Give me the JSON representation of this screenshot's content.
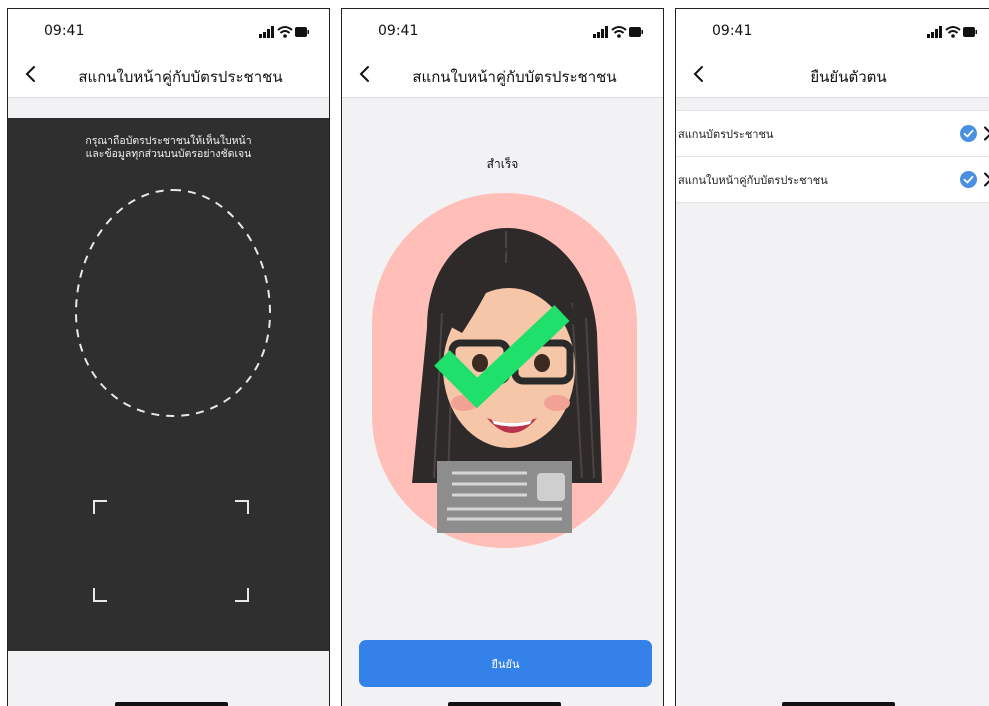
{
  "screens": [
    {
      "time": "09:41",
      "nav_title": "สแกนใบหน้าคู่กับบัตรประชาชน",
      "instruction_lines": [
        "กรุณาถือบัตรประชาชนให้เห็นใบหน้า",
        "และข้อมูลทุกส่วนบนบัตรอย่างชัดเจน"
      ]
    },
    {
      "time": "09:41",
      "nav_title": "สแกนใบหน้าคู่กับบัตรประชาชน",
      "status_text": "สำเร็จ",
      "confirm_label": "ยืนยัน"
    },
    {
      "time": "09:41",
      "nav_title": "ยืนยันตัวตน",
      "items": [
        {
          "label": "สแกนบัตรประชาชน",
          "completed": true
        },
        {
          "label": "สแกนใบหน้าคู่กับบัตรประชาชน",
          "completed": true
        }
      ]
    }
  ],
  "colors": {
    "accent": "#3481e9",
    "check_blue": "#4a90e2",
    "camera_bg": "#2f2f2f",
    "success_check": "#1ee06a",
    "avatar_bg": "#ffbfb8"
  },
  "icons": [
    "back-chevron-icon",
    "signal-icon",
    "wifi-icon",
    "battery-icon",
    "checkmark-circle-icon",
    "chevron-right-icon"
  ]
}
